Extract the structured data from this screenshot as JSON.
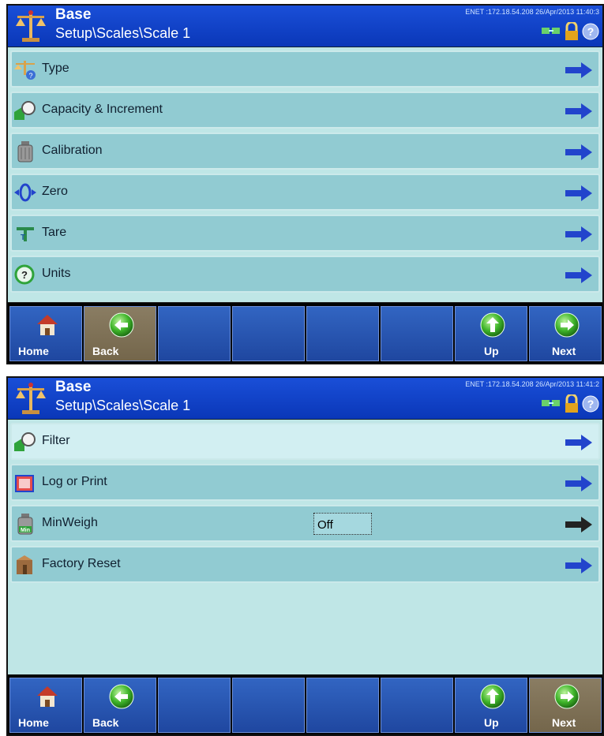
{
  "colors": {
    "header_blue": "#0a37b8",
    "item_teal": "#91cbd2",
    "item_selected": "#d2eff2",
    "arrow_blue": "#2244cc",
    "arrow_disabled": "#222222",
    "key_blue": "#2a56b5",
    "key_active": "#7f7258"
  },
  "screens": [
    {
      "header": {
        "title": "Base",
        "path": "Setup\\Scales\\Scale 1",
        "status": "ENET :172.18.54.208  26/Apr/2013 11:40:3"
      },
      "items": [
        {
          "label": "Type",
          "icon": "scale-type-icon"
        },
        {
          "label": "Capacity & Increment",
          "icon": "capacity-icon"
        },
        {
          "label": "Calibration",
          "icon": "calibration-weight-icon"
        },
        {
          "label": "Zero",
          "icon": "zero-icon"
        },
        {
          "label": "Tare",
          "icon": "tare-icon"
        },
        {
          "label": "Units",
          "icon": "units-icon"
        }
      ],
      "softkeys": [
        {
          "label": "Home",
          "icon": "home-icon"
        },
        {
          "label": "Back",
          "icon": "back-arrow-icon"
        },
        {
          "label": ""
        },
        {
          "label": ""
        },
        {
          "label": ""
        },
        {
          "label": ""
        },
        {
          "label": "Up",
          "icon": "up-arrow-icon"
        },
        {
          "label": "Next",
          "icon": "next-arrow-icon"
        }
      ]
    },
    {
      "header": {
        "title": "Base",
        "path": "Setup\\Scales\\Scale 1",
        "status": "ENET :172.18.54.208  26/Apr/2013 11:41:2"
      },
      "items": [
        {
          "label": "Filter",
          "icon": "filter-icon"
        },
        {
          "label": "Log or Print",
          "icon": "log-print-icon"
        },
        {
          "label": "MinWeigh",
          "icon": "minweigh-icon",
          "value": "Off"
        },
        {
          "label": "Factory Reset",
          "icon": "factory-reset-icon"
        }
      ],
      "softkeys": [
        {
          "label": "Home",
          "icon": "home-icon"
        },
        {
          "label": "Back",
          "icon": "back-arrow-icon"
        },
        {
          "label": ""
        },
        {
          "label": ""
        },
        {
          "label": ""
        },
        {
          "label": ""
        },
        {
          "label": "Up",
          "icon": "up-arrow-icon"
        },
        {
          "label": "Next",
          "icon": "next-arrow-icon"
        }
      ]
    }
  ]
}
